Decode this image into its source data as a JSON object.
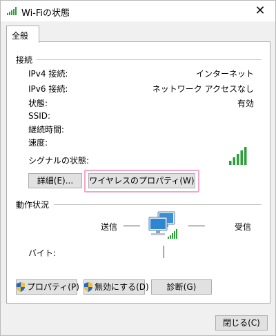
{
  "window": {
    "title": "Wi-Fiの状態",
    "close_glyph": "✕"
  },
  "tabs": [
    {
      "label": "全般"
    }
  ],
  "connection": {
    "group_label": "接続",
    "rows": [
      {
        "label": "IPv4 接続:",
        "value": "インターネット"
      },
      {
        "label": "IPv6 接続:",
        "value": "ネットワーク アクセスなし"
      },
      {
        "label": "状態:",
        "value": "有効"
      },
      {
        "label": "SSID:",
        "value": ""
      },
      {
        "label": "継続時間:",
        "value": ""
      },
      {
        "label": "速度:",
        "value": ""
      }
    ],
    "signal_label": "シグナルの状態:",
    "signal_bars": 5,
    "signal_bars_max": 5
  },
  "buttons": {
    "details": "詳細(E)...",
    "wireless_properties": "ワイヤレスのプロパティ(W)",
    "properties": "プロパティ(P)",
    "disable": "無効にする(D)",
    "diagnose": "診断(G)",
    "close": "閉じる(C)"
  },
  "activity": {
    "group_label": "動作状況",
    "sent_label": "送信",
    "received_label": "受信",
    "bytes_label": "バイト:",
    "sent_value": "",
    "received_value": ""
  },
  "colors": {
    "signal_green": "#2c9e3a",
    "highlight": "#f0a5c9",
    "button_face": "#e1e1e1"
  },
  "icons": {
    "title": "wifi-signal-icon",
    "network": "network-computers-icon",
    "shield": "uac-shield-icon"
  }
}
